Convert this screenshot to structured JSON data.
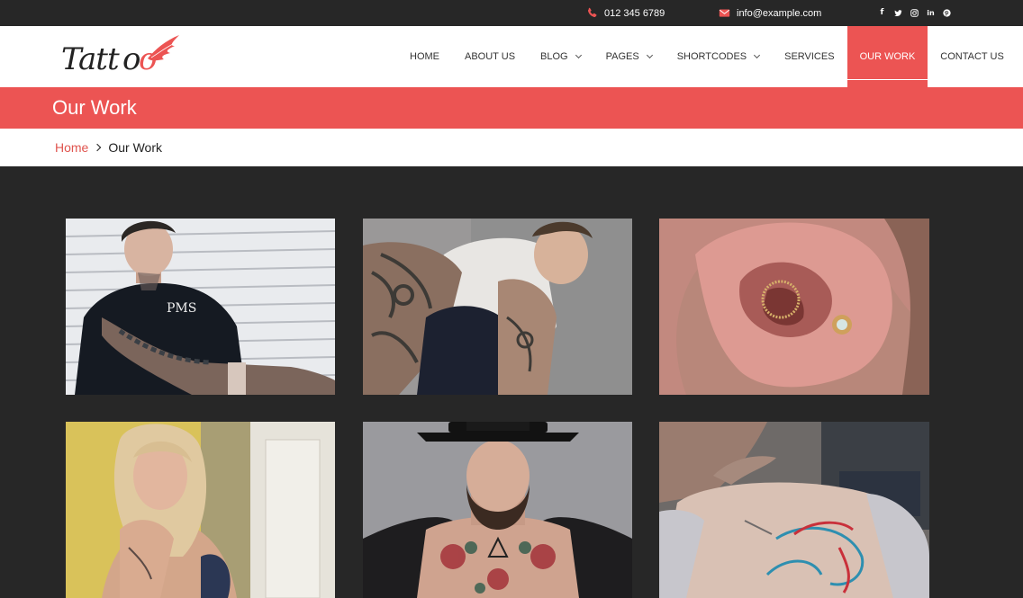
{
  "topbar": {
    "phone": "012 345 6789",
    "email": "info@example.com",
    "social_icons": [
      "facebook-icon",
      "twitter-icon",
      "instagram-icon",
      "linkedin-icon",
      "pinterest-icon"
    ]
  },
  "logo": {
    "text": "Tattoo"
  },
  "nav": {
    "items": [
      {
        "label": "HOME"
      },
      {
        "label": "ABOUT US"
      },
      {
        "label": "BLOG",
        "dropdown": true
      },
      {
        "label": "PAGES",
        "dropdown": true
      },
      {
        "label": "SHORTCODES",
        "dropdown": true
      },
      {
        "label": "SERVICES"
      },
      {
        "label": "OUR WORK",
        "active": true
      },
      {
        "label": "CONTACT US"
      }
    ]
  },
  "page": {
    "title": "Our Work"
  },
  "breadcrumb": {
    "home": "Home",
    "current": "Our Work"
  },
  "colors": {
    "accent": "#ec5453",
    "dark": "#272727",
    "white": "#ffffff"
  },
  "gallery": {
    "items": [
      {
        "alt": "tattooed-man-black-shirt"
      },
      {
        "alt": "tattooed-man-white-tank"
      },
      {
        "alt": "ear-piercing"
      },
      {
        "alt": "woman-with-tattoos"
      },
      {
        "alt": "bearded-man-hat-chest-tattoo"
      },
      {
        "alt": "unicorn-back-tattoo"
      }
    ]
  }
}
